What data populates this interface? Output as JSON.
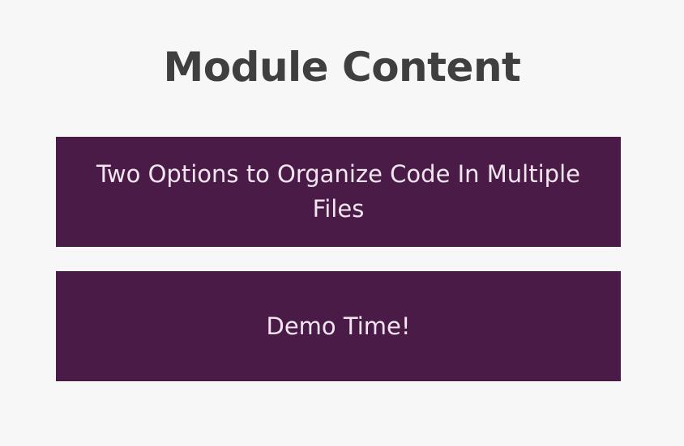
{
  "slide": {
    "title": "Module Content",
    "items": [
      {
        "label": "Two Options to Organize Code In Multiple Files"
      },
      {
        "label": "Demo Time!"
      }
    ]
  },
  "colors": {
    "background": "#f7f7f7",
    "title_text": "#3f3f3f",
    "box_fill": "#4b1b48",
    "box_text": "#f2e6f0"
  }
}
